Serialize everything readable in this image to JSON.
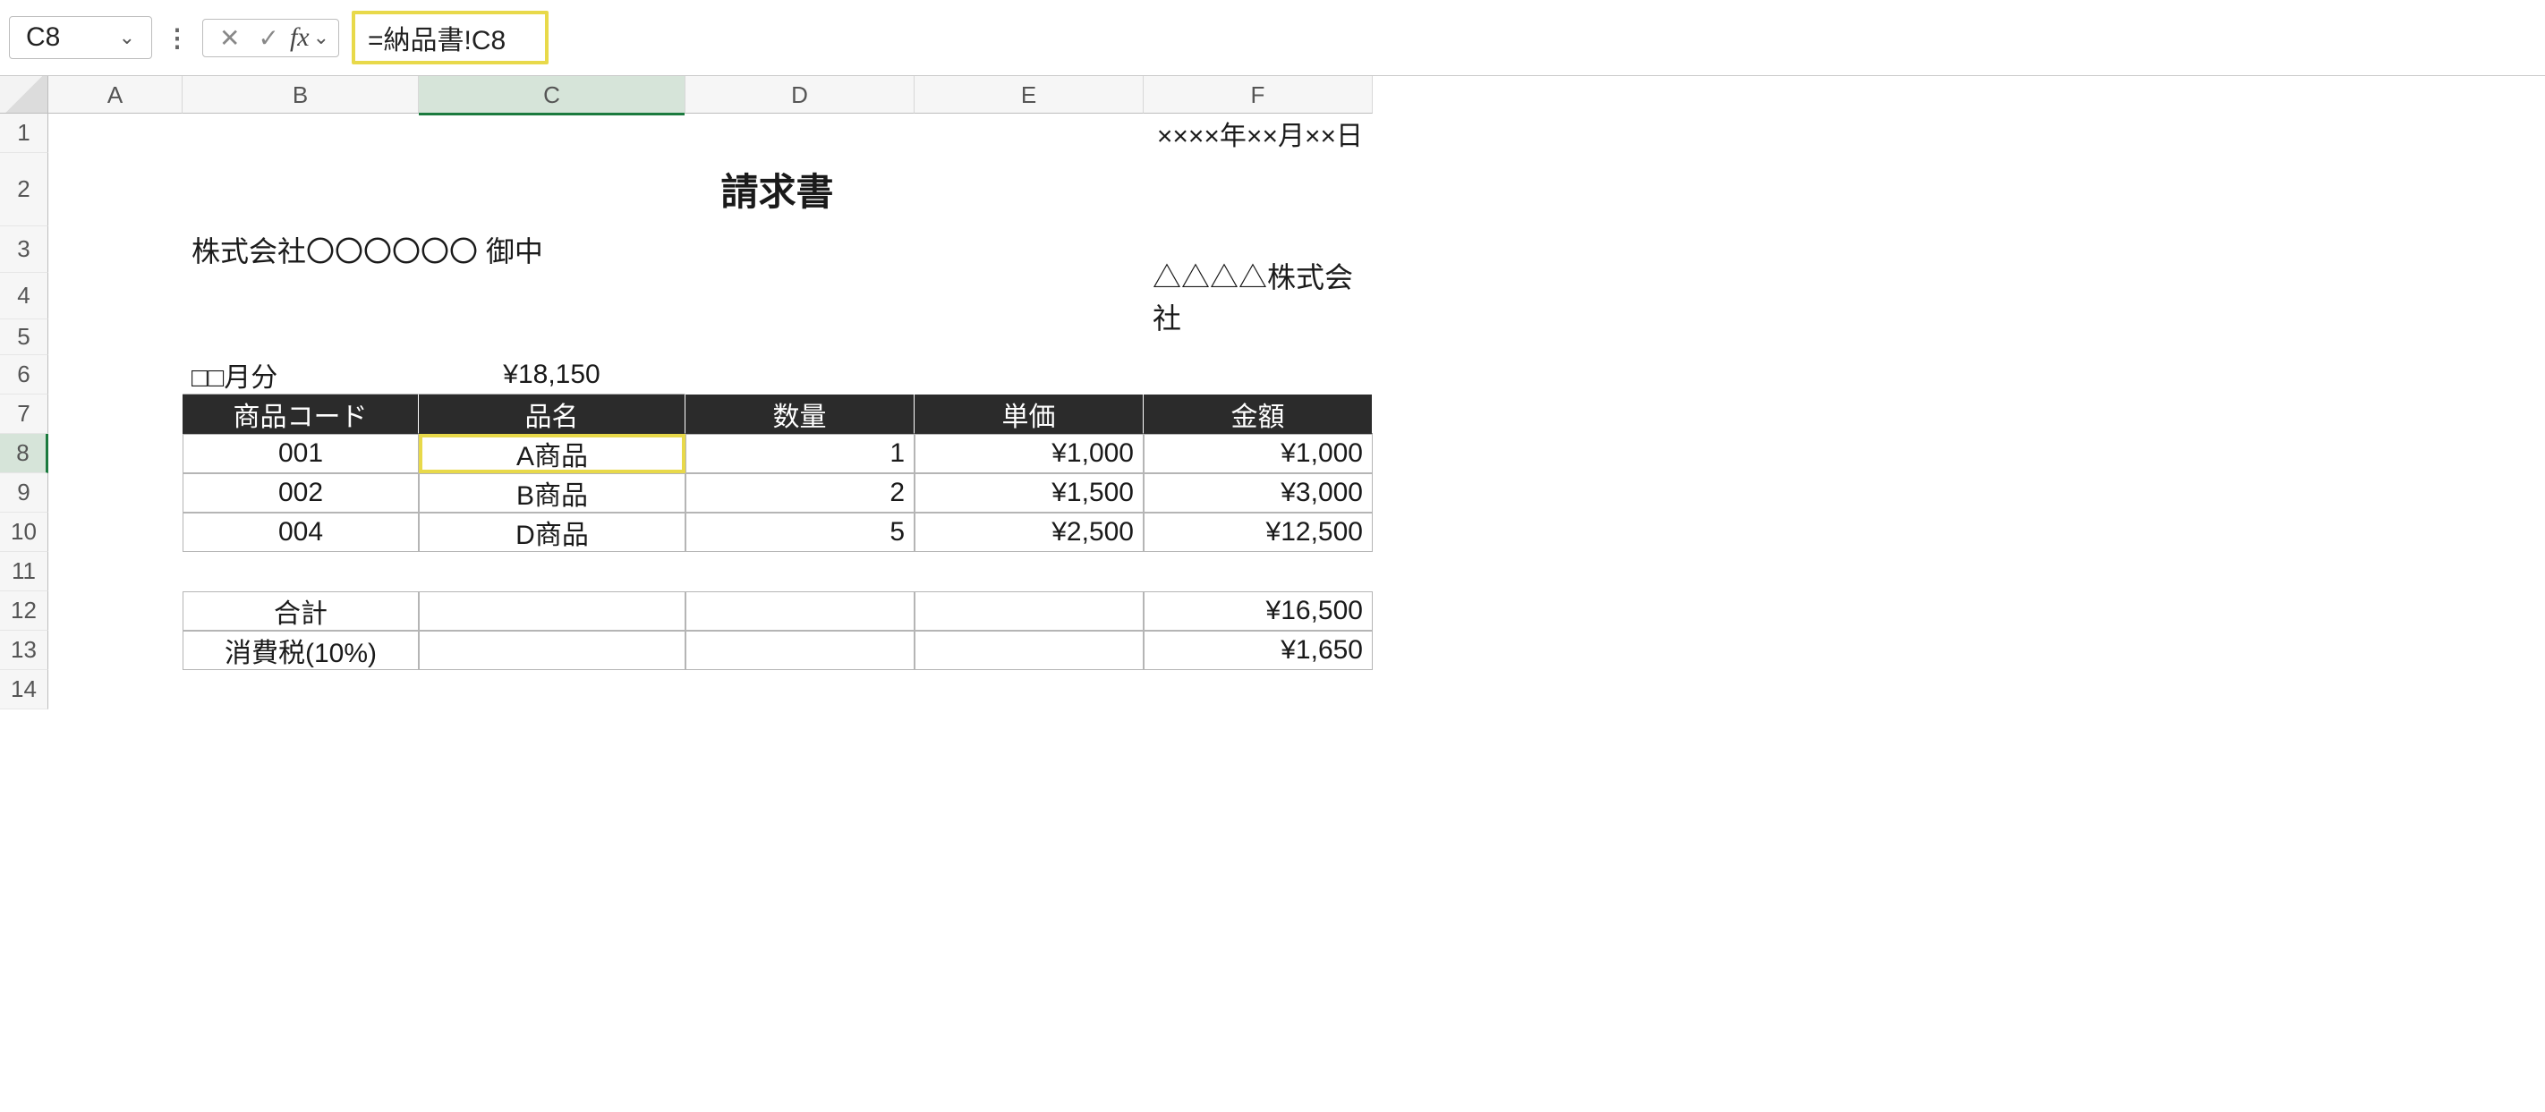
{
  "name_box": "C8",
  "formula": "=納品書!C8",
  "columns": [
    "A",
    "B",
    "C",
    "D",
    "E",
    "F"
  ],
  "active_col": "C",
  "rows": [
    "1",
    "2",
    "3",
    "4",
    "5",
    "6",
    "7",
    "8",
    "9",
    "10",
    "11",
    "12",
    "13",
    "14"
  ],
  "active_row": "8",
  "doc": {
    "date": "××××年××月××日",
    "title": "請求書",
    "recipient": "株式会社〇〇〇〇〇〇  御中",
    "sender": "△△△△株式会社",
    "month_label": "□□月分",
    "total_display": "¥18,150",
    "headers": {
      "code": "商品コード",
      "name": "品名",
      "qty": "数量",
      "unit": "単価",
      "amount": "金額"
    },
    "items": [
      {
        "code": "001",
        "name": "A商品",
        "qty": "1",
        "unit": "¥1,000",
        "amount": "¥1,000"
      },
      {
        "code": "002",
        "name": "B商品",
        "qty": "2",
        "unit": "¥1,500",
        "amount": "¥3,000"
      },
      {
        "code": "004",
        "name": "D商品",
        "qty": "5",
        "unit": "¥2,500",
        "amount": "¥12,500"
      }
    ],
    "sum_label": "合計",
    "sum_value": "¥16,500",
    "tax_label": "消費税(10%)",
    "tax_value": "¥1,650"
  }
}
